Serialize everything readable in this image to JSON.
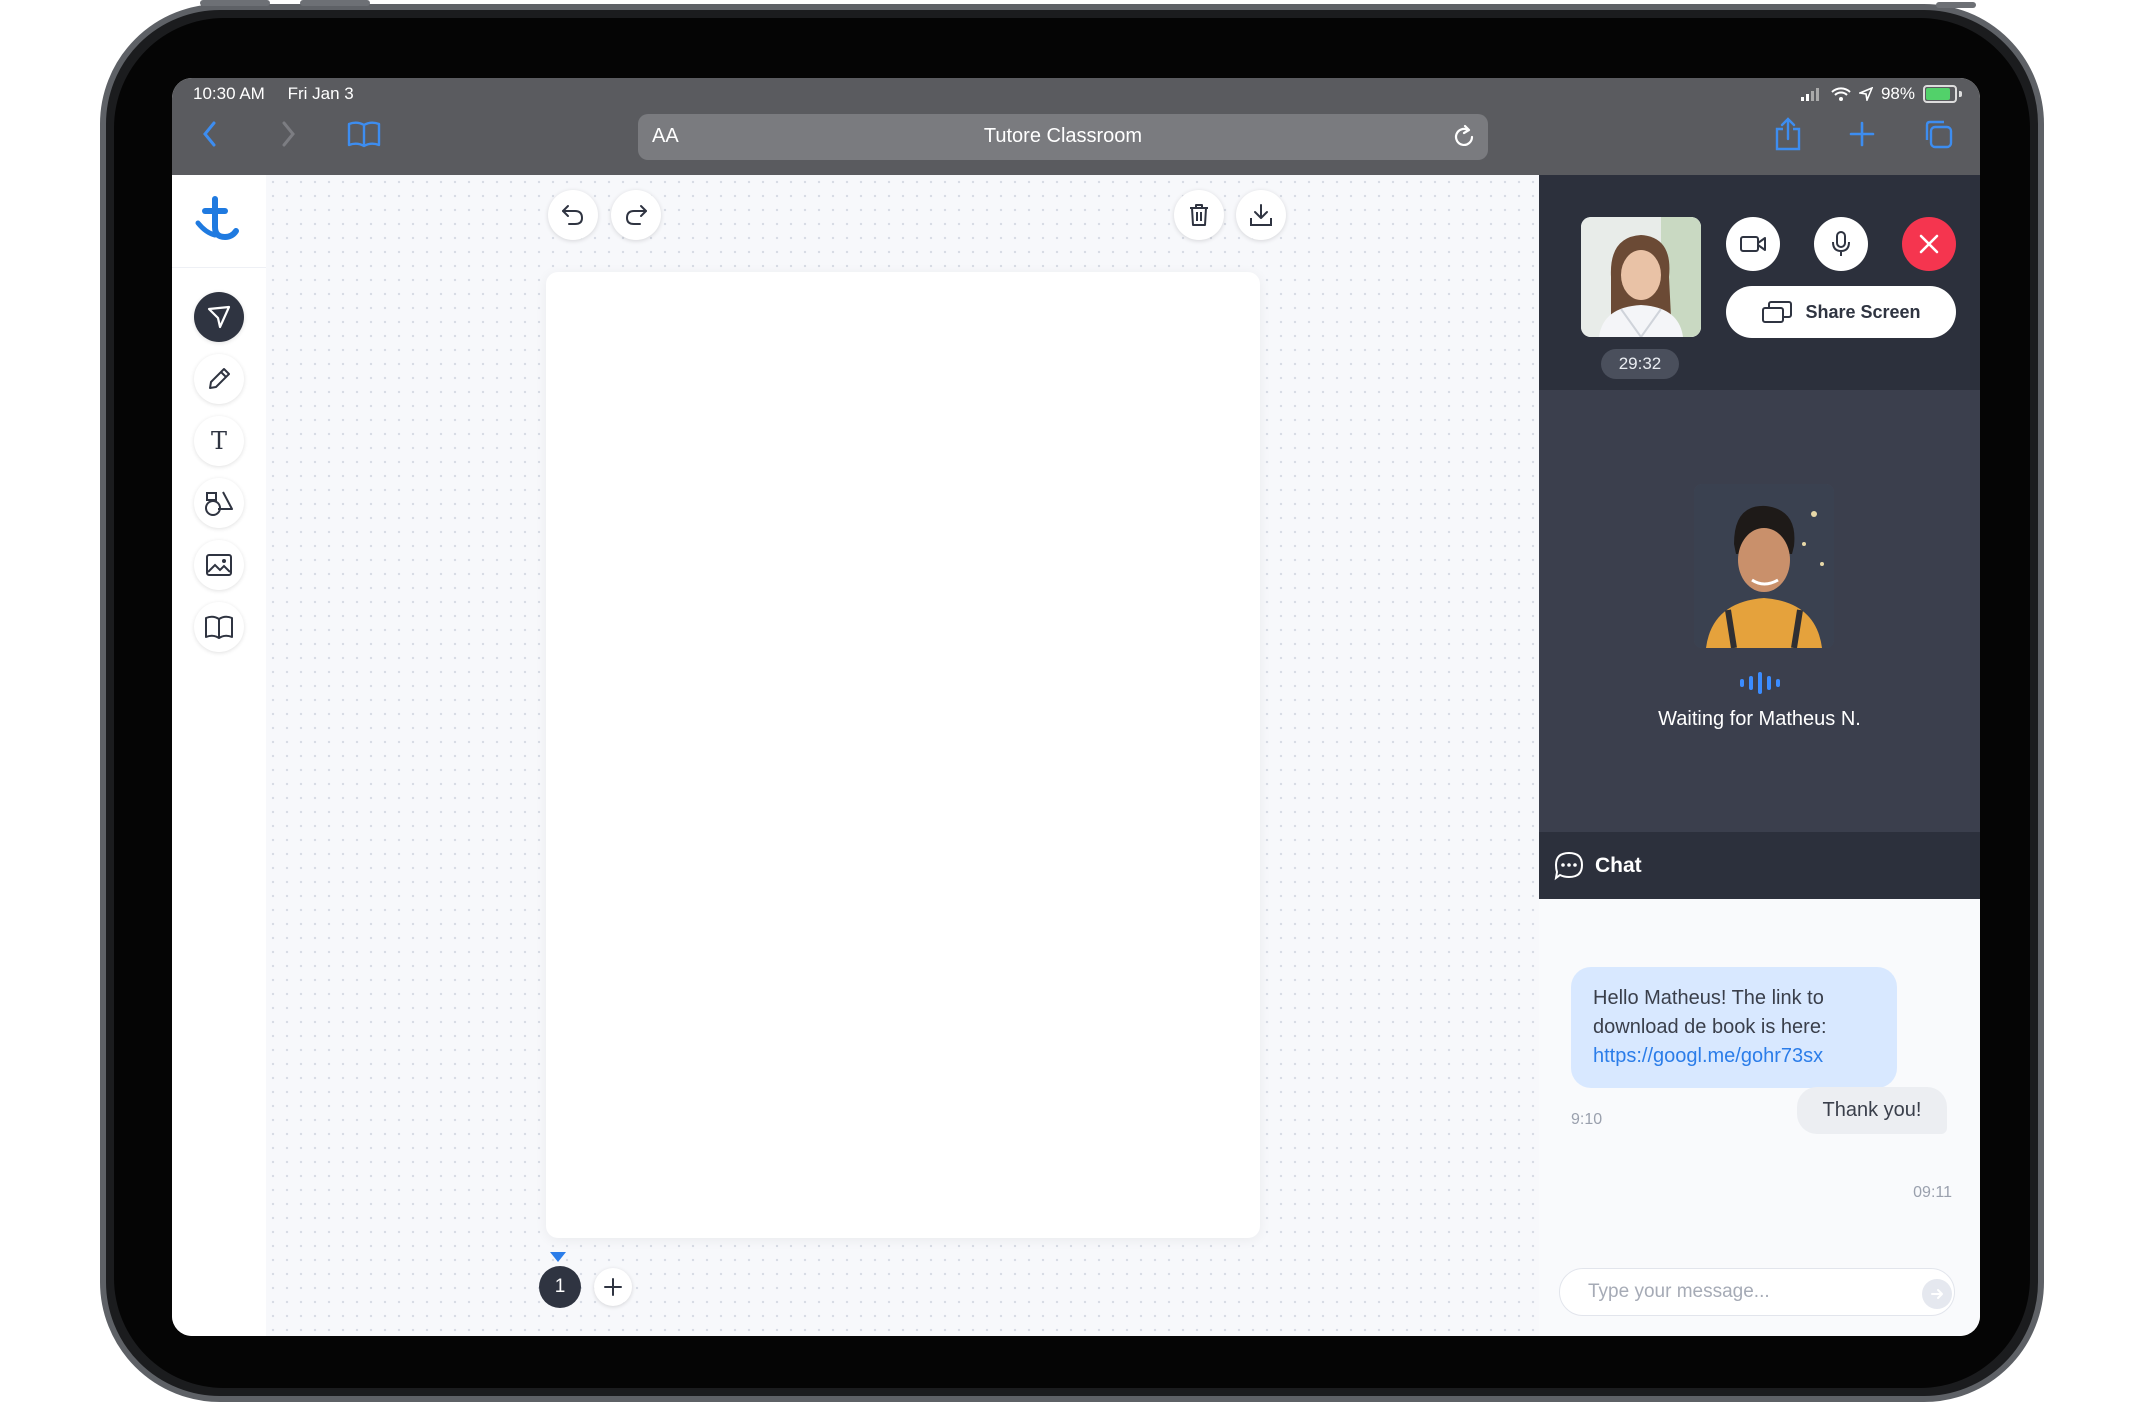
{
  "status_bar": {
    "time": "10:30 AM",
    "date": "Fri Jan 3",
    "battery_percent": "98%",
    "icons": [
      "signal-icon",
      "wifi-icon",
      "location-icon",
      "battery-icon"
    ]
  },
  "browser": {
    "text_size_button": "AA",
    "page_title": "Tutore Classroom",
    "icons": [
      "back-icon",
      "forward-icon",
      "bookmarks-icon",
      "reload-icon",
      "share-icon",
      "new-tab-icon",
      "tabs-icon"
    ]
  },
  "toolbar": {
    "logo": "t",
    "tools": [
      {
        "name": "select",
        "icon": "select-arrow-icon",
        "active": true
      },
      {
        "name": "pen",
        "icon": "pen-icon",
        "active": false
      },
      {
        "name": "text",
        "icon": "text-icon",
        "glyph": "T",
        "active": false
      },
      {
        "name": "shapes",
        "icon": "shapes-icon",
        "active": false
      },
      {
        "name": "image",
        "icon": "image-icon",
        "active": false
      },
      {
        "name": "book",
        "icon": "book-icon",
        "active": false
      }
    ]
  },
  "canvas": {
    "actions": [
      "undo-icon",
      "redo-icon",
      "trash-icon",
      "download-icon"
    ],
    "current_page": "1",
    "add_page_label": "+"
  },
  "video": {
    "self_timer": "29:32",
    "share_screen_label": "Share Screen",
    "waiting_text": "Waiting for Matheus N.",
    "end_call_color": "#f5354f"
  },
  "chat": {
    "title": "Chat",
    "messages": [
      {
        "direction": "incoming",
        "text": "Hello Matheus! The link to download de book is here:",
        "link": "https://googl.me/gohr73sx",
        "time": "9:10"
      },
      {
        "direction": "outgoing",
        "text": "Thank you!",
        "time": "09:11"
      }
    ],
    "input_placeholder": "Type your message..."
  },
  "colors": {
    "accent": "#2b7de9",
    "panel_dark": "#2c303c",
    "incoming_bubble": "#d8e8ff"
  }
}
